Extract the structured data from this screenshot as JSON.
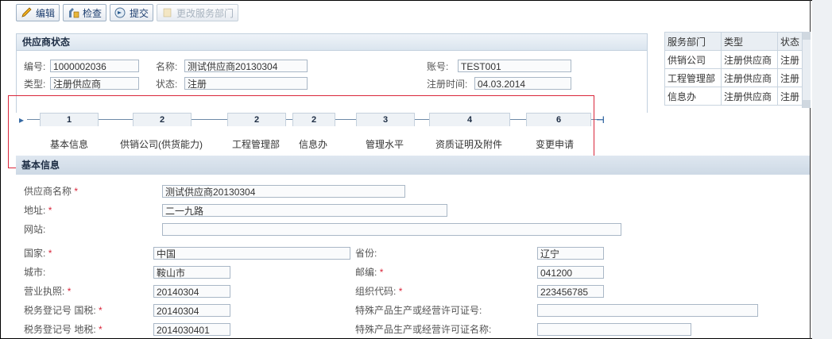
{
  "toolbar": {
    "edit": "编辑",
    "check": "检查",
    "submit": "提交",
    "change_dept": "更改服务部门"
  },
  "status_panel": {
    "title": "供应商状态",
    "number_label": "编号:",
    "number": "1000002036",
    "name_label": "名称:",
    "name": "测试供应商20130304",
    "account_label": "账号:",
    "account": "TEST001",
    "type_label": "类型:",
    "type": "注册供应商",
    "state_label": "状态:",
    "state": "注册",
    "reg_time_label": "注册时间:",
    "reg_time": "04.03.2014"
  },
  "dept_table": {
    "headers": [
      "服务部门",
      "类型",
      "状态"
    ],
    "rows": [
      [
        "供销公司",
        "注册供应商",
        "注册"
      ],
      [
        "工程管理部",
        "注册供应商",
        "注册"
      ],
      [
        "信息办",
        "注册供应商",
        "注册"
      ]
    ]
  },
  "roadmap": {
    "steps": [
      {
        "num": "1",
        "label": "基本信息"
      },
      {
        "num": "2",
        "label": "供销公司(供货能力)"
      },
      {
        "num": "2",
        "label": "工程管理部"
      },
      {
        "num": "2",
        "label": "信息办"
      },
      {
        "num": "3",
        "label": "管理水平"
      },
      {
        "num": "4",
        "label": "资质证明及附件"
      },
      {
        "num": "6",
        "label": "变更申请"
      }
    ]
  },
  "basic_info": {
    "title": "基本信息",
    "supplier_name_label": "供应商名称",
    "supplier_name": "测试供应商20130304",
    "address_label": "地址:",
    "address": "二一九路",
    "website_label": "网站:",
    "website": "",
    "country_label": "国家:",
    "country": "中国",
    "province_label": "省份:",
    "province": "辽宁",
    "city_label": "城市:",
    "city": "鞍山市",
    "postcode_label": "邮编:",
    "postcode": "041200",
    "license_label": "营业执照:",
    "license": "20140304",
    "org_code_label": "组织代码:",
    "org_code": "223456785",
    "tax_national_label": "税务登记号 国税:",
    "tax_national": "20140304",
    "special_permit_label": "特殊产品生产或经营许可证号:",
    "special_permit": "",
    "tax_local_label": "税务登记号 地税:",
    "tax_local": "2014030401",
    "special_permit_name_label": "特殊产品生产或经营许可证名称:",
    "special_permit_name": ""
  },
  "colors": {
    "accent": "#1a3c6e",
    "required": "#d9263b",
    "highlight_box": "#d9263b"
  }
}
